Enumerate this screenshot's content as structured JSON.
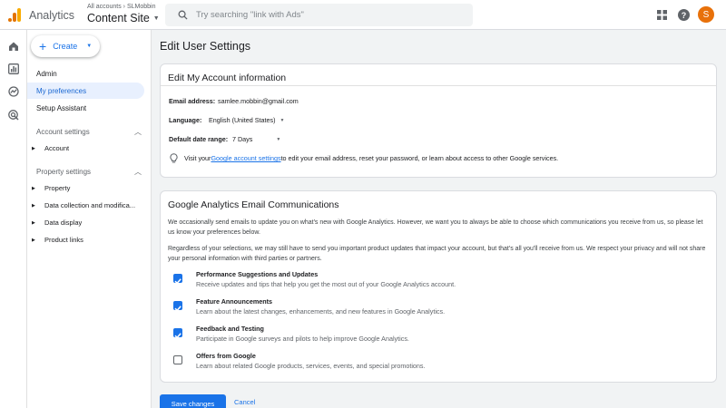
{
  "header": {
    "app_name": "Analytics",
    "account_crumb": "All accounts › SLMobbin",
    "property_name": "Content Site",
    "search_placeholder": "Try searching \"link with Ads\"",
    "avatar_letter": "S",
    "icons": [
      "analytics-logo-icon",
      "search-icon",
      "apps-grid-icon",
      "help-icon"
    ]
  },
  "rail": {
    "icons": [
      "home-icon",
      "reports-icon",
      "explore-icon",
      "advertising-icon"
    ]
  },
  "sidebar": {
    "create_label": "Create",
    "items": [
      {
        "label": "Admin",
        "active": false
      },
      {
        "label": "My preferences",
        "active": true
      },
      {
        "label": "Setup Assistant",
        "active": false
      }
    ],
    "account_settings": {
      "title": "Account settings",
      "items": [
        "Account"
      ]
    },
    "property_settings": {
      "title": "Property settings",
      "items": [
        "Property",
        "Data collection and modifica...",
        "Data display",
        "Product links"
      ]
    }
  },
  "main": {
    "page_title": "Edit User Settings",
    "account_card": {
      "title": "Edit My Account information",
      "email_label": "Email address:",
      "email_value": "samlee.mobbin@gmail.com",
      "language_label": "Language:",
      "language_value": "English (United States)",
      "date_range_label": "Default date range:",
      "date_range_value": "7 Days",
      "tip_prefix": "Visit your ",
      "tip_link": "Google account settings",
      "tip_suffix": " to edit your email address, reset your password, or learn about access to other Google services."
    },
    "email_card": {
      "title": "Google Analytics Email Communications",
      "para1": "We occasionally send emails to update you on what's new with Google Analytics. However, we want you to always be able to choose which communications you receive from us, so please let us know your preferences below.",
      "para2": "Regardless of your selections, we may still have to send you important product updates that impact your account, but that's all you'll receive from us. We respect your privacy and will not share your personal information with third parties or partners.",
      "options": [
        {
          "title": "Performance Suggestions and Updates",
          "desc": "Receive updates and tips that help you get the most out of your Google Analytics account.",
          "checked": true
        },
        {
          "title": "Feature Announcements",
          "desc": "Learn about the latest changes, enhancements, and new features in Google Analytics.",
          "checked": true
        },
        {
          "title": "Feedback and Testing",
          "desc": "Participate in Google surveys and pilots to help improve Google Analytics.",
          "checked": true
        },
        {
          "title": "Offers from Google",
          "desc": "Learn about related Google products, services, events, and special promotions.",
          "checked": false
        }
      ]
    },
    "save_label": "Save changes",
    "cancel_label": "Cancel"
  },
  "colors": {
    "accent": "#1a73e8",
    "active_bg": "#e8f0fe",
    "avatar": "#e8710a",
    "logo_orange": "#f9ab00",
    "logo_dark_orange": "#e37400"
  }
}
